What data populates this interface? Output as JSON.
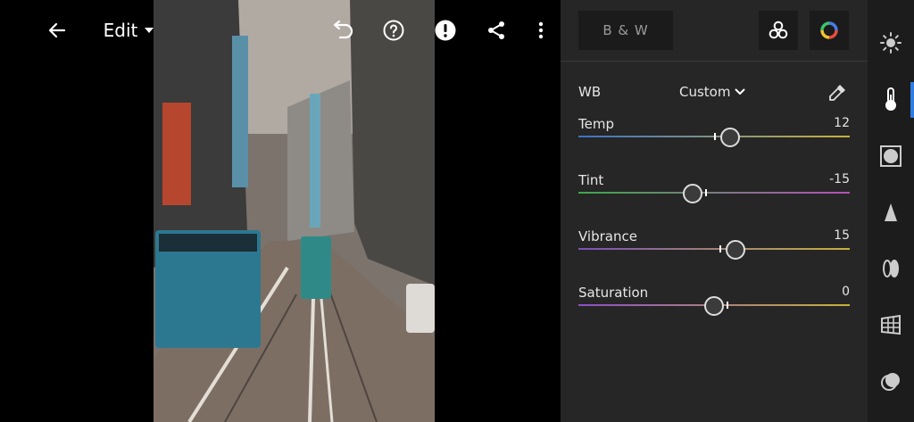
{
  "topbar": {
    "edit_label": "Edit"
  },
  "panel": {
    "bw_label": "B & W",
    "wb_label": "WB",
    "wb_value": "Custom",
    "sliders": [
      {
        "label": "Temp",
        "value": "12",
        "fraction": 0.56,
        "gradient": [
          "#3a73c8",
          "#c7b13b"
        ]
      },
      {
        "label": "Tint",
        "value": "-15",
        "fraction": 0.42,
        "gradient": [
          "#3ea84a",
          "#b64fb8"
        ]
      },
      {
        "label": "Vibrance",
        "value": "15",
        "fraction": 0.58,
        "gradient": [
          "#7b4fb8",
          "#c7b13b"
        ]
      },
      {
        "label": "Saturation",
        "value": "0",
        "fraction": 0.5,
        "gradient": [
          "#8a4fc8",
          "#c7b13b"
        ]
      }
    ]
  },
  "rail": {
    "icons": [
      "light-icon",
      "color-icon",
      "effects-icon",
      "detail-icon",
      "optics-icon",
      "geometry-icon",
      "selective-icon"
    ]
  },
  "colors": {
    "accent": "#2f7de1",
    "panel_bg": "#262626",
    "rail_bg": "#1c1c1c"
  }
}
